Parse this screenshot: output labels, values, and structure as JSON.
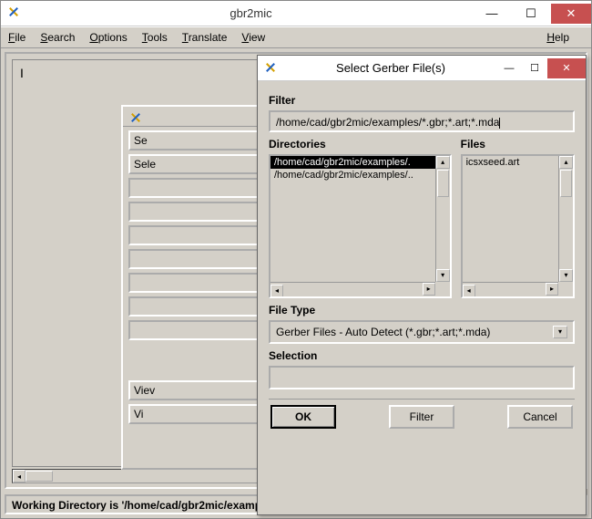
{
  "main": {
    "title": "gbr2mic",
    "menu": {
      "file": "File",
      "search": "Search",
      "options": "Options",
      "tools": "Tools",
      "translate": "Translate",
      "view": "View",
      "help": "Help"
    },
    "status": "Working Directory is '/home/cad/gbr2mic/examples'"
  },
  "bgpanel": {
    "row1": "Se",
    "row2": "Sele",
    "view": "Viev",
    "vi": "Vi"
  },
  "dialog": {
    "title": "Select Gerber File(s)",
    "filter_label": "Filter",
    "filter_value": "/home/cad/gbr2mic/examples/*.gbr;*.art;*.mda",
    "dir_label": "Directories",
    "files_label": "Files",
    "directories": [
      "/home/cad/gbr2mic/examples/.",
      "/home/cad/gbr2mic/examples/.."
    ],
    "files": [
      "icsxseed.art"
    ],
    "filetype_label": "File Type",
    "filetype_value": "Gerber Files - Auto Detect (*.gbr;*.art;*.mda)",
    "selection_label": "Selection",
    "selection_value": "",
    "buttons": {
      "ok": "OK",
      "filter": "Filter",
      "cancel": "Cancel"
    }
  }
}
